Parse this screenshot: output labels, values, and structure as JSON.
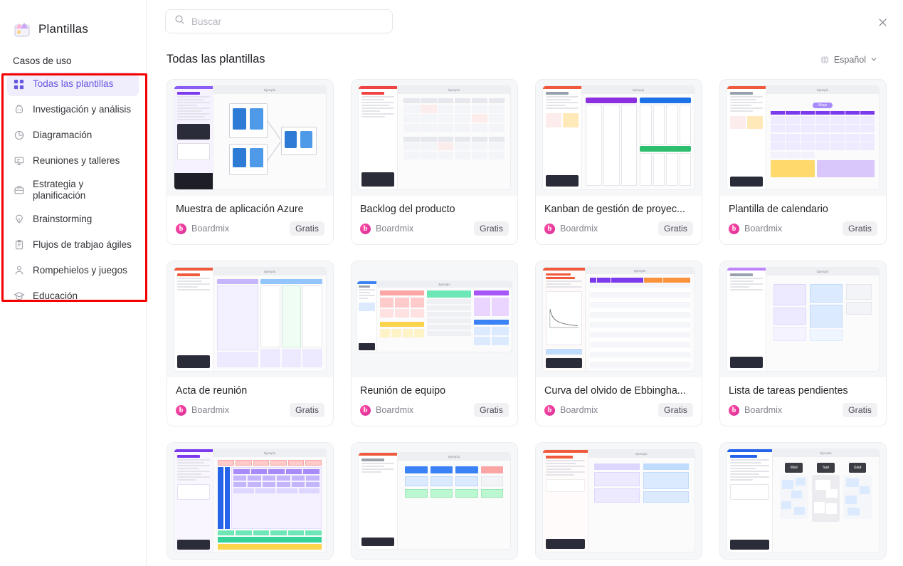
{
  "sidebar": {
    "brand": {
      "title": "Plantillas",
      "icon": "templates-icon"
    },
    "section_label": "Casos de uso",
    "items": [
      {
        "label": "Todas las plantillas",
        "icon": "grid-icon",
        "active": true
      },
      {
        "label": "Investigación y análisis",
        "icon": "research-icon",
        "active": false
      },
      {
        "label": "Diagramación",
        "icon": "chart-pie-icon",
        "active": false
      },
      {
        "label": "Reuniones y talleres",
        "icon": "presentation-icon",
        "active": false
      },
      {
        "label": "Estrategia y\nplanificación",
        "icon": "briefcase-icon",
        "active": false
      },
      {
        "label": "Brainstorming",
        "icon": "lightbulb-icon",
        "active": false
      },
      {
        "label": "Flujos de trabjao ágiles",
        "icon": "clipboard-icon",
        "active": false
      },
      {
        "label": "Rompehielos y juegos",
        "icon": "people-icon",
        "active": false
      },
      {
        "label": "Educación",
        "icon": "graduation-cap-icon",
        "active": false
      }
    ]
  },
  "topbar": {
    "search": {
      "placeholder": "Buscar",
      "value": "",
      "icon": "search-icon"
    },
    "close": {
      "icon": "close-icon"
    }
  },
  "content": {
    "title": "Todas las plantillas",
    "language": {
      "label": "Español",
      "icon": "globe-icon",
      "chevron": "chevron-down-icon"
    }
  },
  "colors": {
    "accent": "#6557e0",
    "accent_bg": "#f0eefc",
    "annotation": "#f40000",
    "badge_bg": "#f1f1f4",
    "brand_pink": "#e0339b"
  },
  "cards": [
    {
      "title": "Muestra de aplicación Azure",
      "author": "Boardmix",
      "badge": "Gratis",
      "thumb": {
        "type": "azure-architecture",
        "header": "Ejemplo",
        "accent": "#8b5cf6"
      }
    },
    {
      "title": "Backlog del producto",
      "author": "Boardmix",
      "badge": "Gratis",
      "thumb": {
        "type": "backlog-table",
        "header": "Ejemplo",
        "accent": "#ef4444"
      }
    },
    {
      "title": "Kanban de gestión de proyec...",
      "author": "Boardmix",
      "badge": "Gratis",
      "thumb": {
        "type": "kanban-board",
        "header": "Ejemplo",
        "accent": "#ef5a3c"
      }
    },
    {
      "title": "Plantilla de calendario",
      "author": "Boardmix",
      "badge": "Gratis",
      "thumb": {
        "type": "calendar",
        "header": "Ejemplo",
        "month": "Mayo",
        "accent": "#ef5a3c"
      }
    },
    {
      "title": "Acta de reunión",
      "author": "Boardmix",
      "badge": "Gratis",
      "thumb": {
        "type": "meeting-minutes",
        "header": "Ejemplo",
        "accent": "#ef5a3c"
      }
    },
    {
      "title": "Reunión de equipo",
      "author": "Boardmix",
      "badge": "Gratis",
      "thumb": {
        "type": "team-meeting",
        "header": "Ejemplo",
        "accent": "#3b82f6"
      }
    },
    {
      "title": "Curva del olvido de Ebbingha...",
      "author": "Boardmix",
      "badge": "Gratis",
      "thumb": {
        "type": "forgetting-curve",
        "header": "Ejemplo",
        "accent": "#ef5a3c"
      }
    },
    {
      "title": "Lista de tareas pendientes",
      "author": "Boardmix",
      "badge": "Gratis",
      "thumb": {
        "type": "todo-list",
        "header": "Ejemplo",
        "accent": "#a855f7"
      }
    },
    {
      "title": "",
      "author": "",
      "badge": "",
      "thumb": {
        "type": "architecture-diagram",
        "header": "Ejemplo",
        "accent": "#7c3aed"
      }
    },
    {
      "title": "",
      "author": "",
      "badge": "",
      "thumb": {
        "type": "flowchart",
        "header": "Ejemplo",
        "accent": "#ef5a3c"
      }
    },
    {
      "title": "",
      "author": "",
      "badge": "",
      "thumb": {
        "type": "sticky-notes",
        "header": "Ejemplo",
        "accent": "#ef5a3c"
      }
    },
    {
      "title": "",
      "author": "",
      "badge": "",
      "thumb": {
        "type": "mad-sad-glad",
        "header": "Ejemplo",
        "accent": "#2563eb",
        "columns": [
          "Mad",
          "Sad",
          "Glad"
        ]
      }
    }
  ]
}
